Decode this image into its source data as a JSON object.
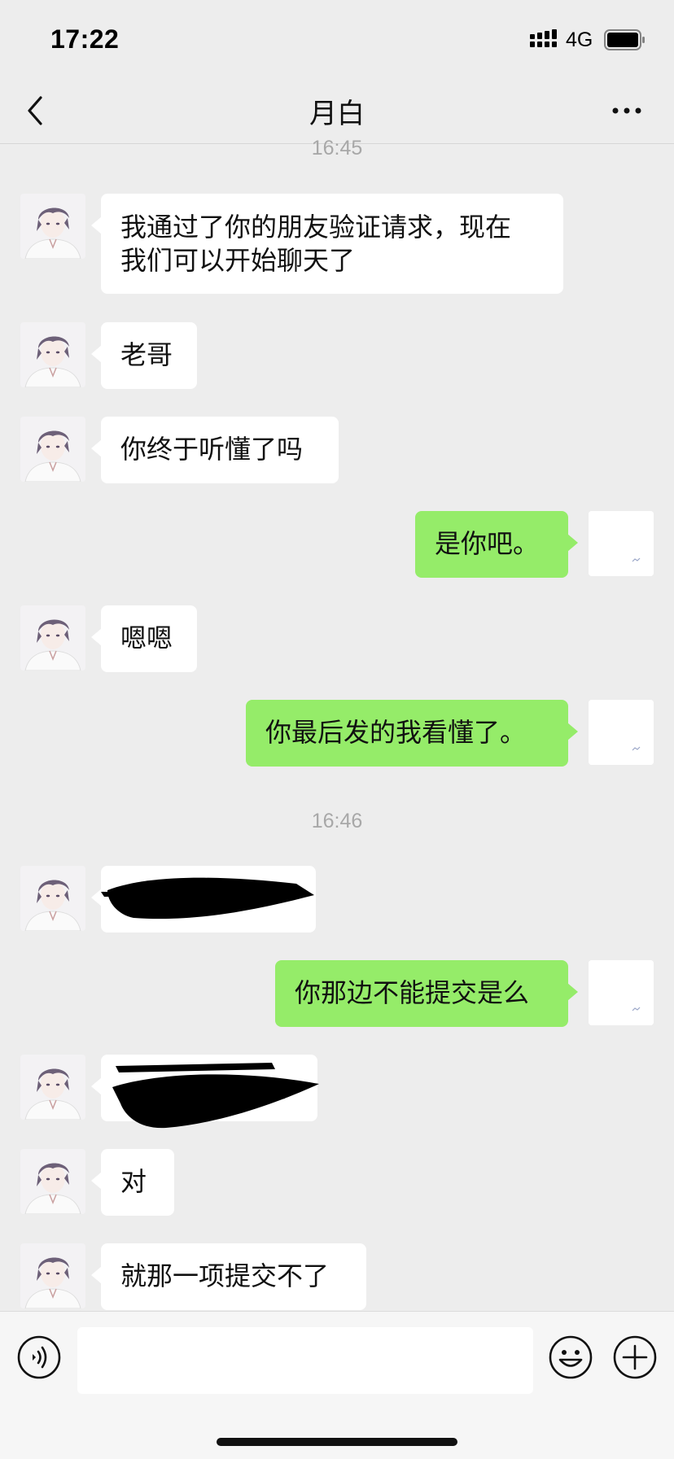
{
  "status_bar": {
    "time": "17:22",
    "network": "4G",
    "signal_icon": "signal-bars-icon",
    "battery_icon": "battery-icon"
  },
  "nav": {
    "title": "月白",
    "back_icon": "chevron-left-icon",
    "more_icon": "more-dots-icon"
  },
  "messages": {
    "t1": "16:45",
    "m1_line1": "我通过了你的朋友验证请求，现在",
    "m1_line2": "我们可以开始聊天了",
    "m2": "老哥",
    "m3": "你终于听懂了吗",
    "m4": "是你吧。",
    "m5": "嗯嗯",
    "m6": "你最后发的我看懂了。",
    "t2": "16:46",
    "m8": "你那边不能提交是么",
    "m10": "对",
    "m11": "就那一项提交不了"
  },
  "input_bar": {
    "voice_icon": "voice-icon",
    "emoji_icon": "emoji-icon",
    "plus_icon": "plus-circle-icon"
  },
  "colors": {
    "background": "#ededed",
    "outgoing_bubble": "#95ec69",
    "incoming_bubble": "#ffffff"
  }
}
